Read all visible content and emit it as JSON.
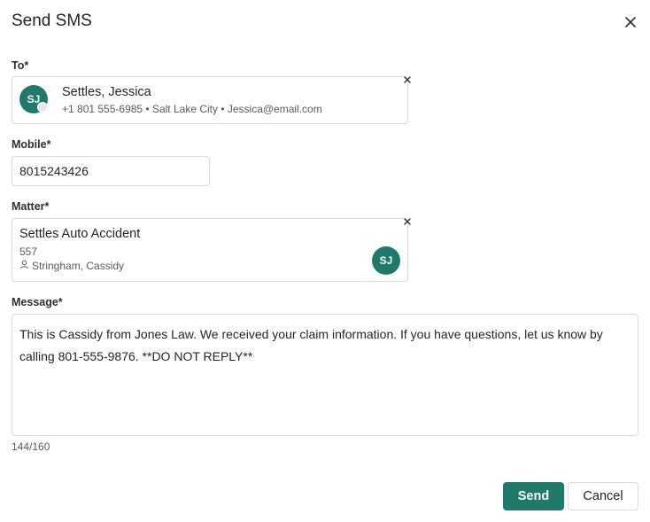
{
  "dialog": {
    "title": "Send SMS"
  },
  "to": {
    "label": "To*",
    "contact": {
      "initials": "SJ",
      "name": "Settles, Jessica",
      "details": "+1 801 555-6985 • Salt Lake City • Jessica@email.com"
    }
  },
  "mobile": {
    "label": "Mobile*",
    "value": "8015243426"
  },
  "matter": {
    "label": "Matter*",
    "name": "Settles Auto Accident",
    "number": "557",
    "owner": "Stringham, Cassidy",
    "initials": "SJ"
  },
  "message": {
    "label": "Message*",
    "value": "This is Cassidy from Jones Law. We received your claim information. If you have questions, let us know by calling 801-555-9876. **DO NOT REPLY**",
    "counter": "144/160"
  },
  "actions": {
    "send_label": "Send",
    "cancel_label": "Cancel"
  },
  "colors": {
    "accent": "#1f7a6b",
    "border": "#d7dadd"
  },
  "icons": {
    "close": "close-icon",
    "remove": "remove-icon",
    "person": "person-icon"
  }
}
